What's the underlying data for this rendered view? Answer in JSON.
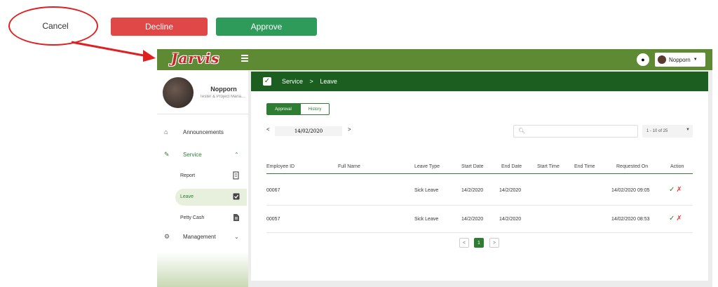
{
  "actions": {
    "cancel": "Cancel",
    "decline": "Decline",
    "approve": "Approve",
    "decline_color": "#e04848",
    "approve_color": "#2e9b5a"
  },
  "topbar": {
    "logo": "Jarvis",
    "user_name": "Nopporn",
    "bg_color": "#5e8a33"
  },
  "sidebar": {
    "profile_name": "Nopporn",
    "profile_role": "Tester & Project Mana...",
    "nav": [
      {
        "label": "Announcements",
        "icon": "home-icon"
      },
      {
        "label": "Service",
        "icon": "pencil-icon"
      },
      {
        "label": "Management",
        "icon": "gear-icon"
      }
    ],
    "service_sub": [
      {
        "label": "Report",
        "icon": "report-icon"
      },
      {
        "label": "Leave",
        "icon": "checkbox-icon"
      },
      {
        "label": "Petty Cash",
        "icon": "document-icon"
      }
    ]
  },
  "content": {
    "breadcrumb": {
      "section": "Service",
      "separator": ">",
      "page": "Leave"
    },
    "tabs": [
      "Approval",
      "History"
    ],
    "date": "14/02/2020",
    "search_placeholder": "",
    "page_size_label": "1 - 10 of 25",
    "columns": [
      "Employee ID",
      "Full Name",
      "Leave Type",
      "Start Date",
      "End Date",
      "Start Time",
      "End Time",
      "Requested On",
      "Action"
    ],
    "rows": [
      {
        "employee_id": "00067",
        "full_name": "",
        "leave_type": "Sick Leave",
        "start_date": "14/2/2020",
        "end_date": "14/2/2020",
        "start_time": "",
        "end_time": "",
        "requested_on": "14/02/2020 09:05"
      },
      {
        "employee_id": "00057",
        "full_name": "",
        "leave_type": "Sick Leave",
        "start_date": "14/2/2020",
        "end_date": "14/2/2020",
        "start_time": "",
        "end_time": "",
        "requested_on": "14/02/2020 08:53"
      }
    ],
    "pagination": {
      "prev": "<",
      "current": "1",
      "next": ">"
    },
    "accent": "#1b5e20"
  }
}
